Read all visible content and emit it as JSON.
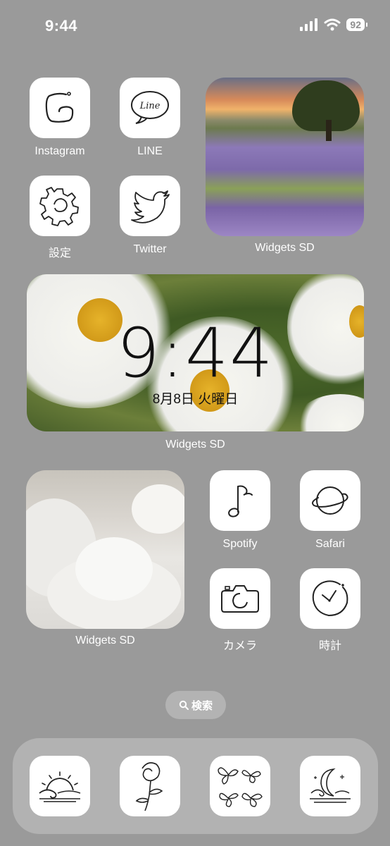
{
  "status": {
    "time": "9:44",
    "battery": "92"
  },
  "apps": {
    "instagram": "Instagram",
    "line": "LINE",
    "line_logo_text": "Line",
    "settings": "設定",
    "twitter": "Twitter",
    "spotify": "Spotify",
    "safari": "Safari",
    "camera": "カメラ",
    "clock": "時計"
  },
  "widgets": {
    "landscape_label": "Widgets SD",
    "clock_label": "Widgets SD",
    "clock_time": "9:44",
    "clock_date": "8月8日 火曜日",
    "bouquet_label": "Widgets SD"
  },
  "search": {
    "label": "検索"
  },
  "icons": {
    "status": [
      "cellular-signal-icon",
      "wifi-icon",
      "battery-icon"
    ],
    "dock": [
      "sun-waves-icon",
      "rose-icon",
      "butterflies-icon",
      "moon-waves-icon"
    ]
  }
}
